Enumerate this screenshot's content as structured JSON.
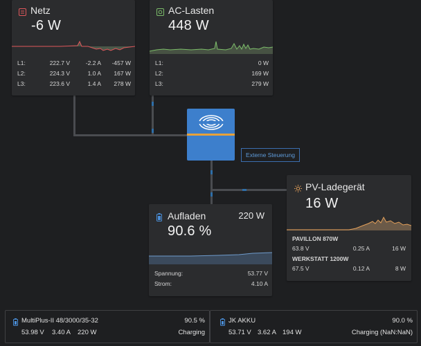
{
  "netz": {
    "title": "Netz",
    "value": "-6 W",
    "rows": [
      {
        "phase": "L1:",
        "voltage": "222.7 V",
        "current": "-2.2 A",
        "power": "-457 W"
      },
      {
        "phase": "L2:",
        "voltage": "224.3 V",
        "current": "1.0 A",
        "power": "167 W"
      },
      {
        "phase": "L3:",
        "voltage": "223.6 V",
        "current": "1.4 A",
        "power": "278 W"
      }
    ],
    "color": "#e0575b"
  },
  "ac_lasten": {
    "title": "AC-Lasten",
    "value": "448 W",
    "rows": [
      {
        "phase": "L1:",
        "power": "0 W"
      },
      {
        "phase": "L2:",
        "power": "169 W"
      },
      {
        "phase": "L3:",
        "power": "279 W"
      }
    ],
    "color": "#7cbd6a"
  },
  "inverter": {
    "link_label": "Externe Steuerung",
    "color": "#3d7fcc"
  },
  "pv": {
    "title": "PV-Ladegerät",
    "value": "16 W",
    "chargers": [
      {
        "name": "PAVILLON 870W",
        "voltage": "63.8 V",
        "current": "0.25 A",
        "power": "16 W"
      },
      {
        "name": "WERKSTATT 1200W",
        "voltage": "67.5 V",
        "current": "0.12 A",
        "power": "8 W"
      }
    ],
    "color": "#e4a05a"
  },
  "battery": {
    "title": "Aufladen",
    "power": "220 W",
    "soc": "90.6 %",
    "voltage_label": "Spannung:",
    "voltage": "53.77 V",
    "current_label": "Strom:",
    "current": "4.10 A",
    "color": "#4a8ed8"
  },
  "devices": [
    {
      "name": "MultiPlus-II 48/3000/35-32",
      "soc": "90.5 %",
      "voltage": "53.98 V",
      "current": "3.40 A",
      "power": "220 W",
      "state": "Charging"
    },
    {
      "name": "JK AKKU",
      "soc": "90.0 %",
      "voltage": "53.71 V",
      "current": "3.62 A",
      "power": "194 W",
      "state": "Charging (NaN:NaN)"
    }
  ]
}
